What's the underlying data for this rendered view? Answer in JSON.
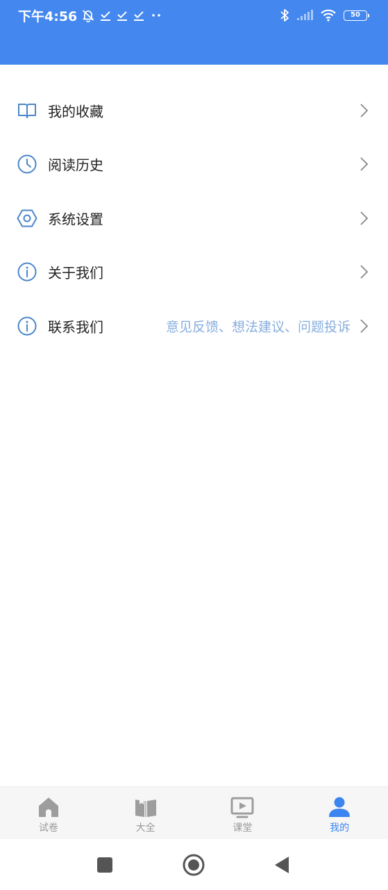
{
  "status_bar": {
    "time": "下午4:56",
    "battery": "50"
  },
  "menu": {
    "items": [
      {
        "label": "我的收藏",
        "icon": "book-icon"
      },
      {
        "label": "阅读历史",
        "icon": "clock-icon"
      },
      {
        "label": "系统设置",
        "icon": "settings-hex-icon"
      },
      {
        "label": "关于我们",
        "icon": "info-icon"
      },
      {
        "label": "联系我们",
        "icon": "info-icon",
        "subtext": "意见反馈、想法建议、问题投诉"
      }
    ]
  },
  "tabbar": {
    "tabs": [
      {
        "label": "试卷",
        "icon": "home-icon",
        "active": false
      },
      {
        "label": "大全",
        "icon": "open-book-icon",
        "active": false
      },
      {
        "label": "课堂",
        "icon": "video-play-icon",
        "active": false
      },
      {
        "label": "我的",
        "icon": "user-icon",
        "active": true
      }
    ]
  },
  "colors": {
    "primary": "#4387ef",
    "tab_active": "#3c84ef",
    "tab_inactive": "#999999",
    "icon_outline": "#4a86c8",
    "subtext": "#86aedf"
  }
}
